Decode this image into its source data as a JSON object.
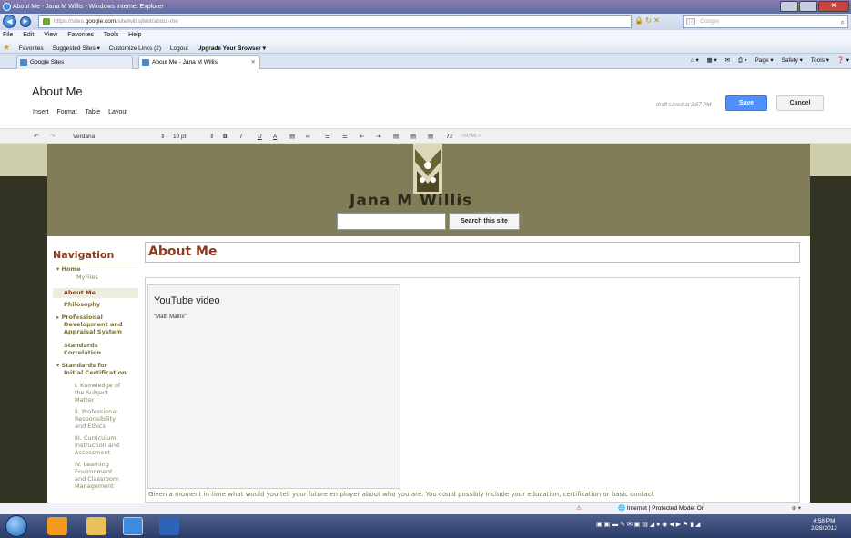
{
  "window": {
    "title": "About Me - Jana M Willis - Windows Internet Explorer",
    "controls": [
      "minimize",
      "maximize",
      "close"
    ]
  },
  "address_bar": {
    "url_prefix": "https://sites.",
    "url_domain": "google.com",
    "url_path": "/site/willisjtest/about-me",
    "search_placeholder": "Google"
  },
  "menu": [
    "File",
    "Edit",
    "View",
    "Favorites",
    "Tools",
    "Help"
  ],
  "favorites_bar": {
    "favorites_label": "Favorites",
    "links": [
      "Suggested Sites ▾",
      "Customize Links (2)",
      "Logout",
      "Upgrade Your Browser ▾"
    ]
  },
  "tabs": [
    {
      "label": "Google Sites"
    },
    {
      "label": "About Me - Jana M Willis"
    }
  ],
  "command_bar": [
    "Page ▾",
    "Safety ▾",
    "Tools ▾"
  ],
  "editor": {
    "page_title": "About Me",
    "draft_status": "draft saved at 2:57 PM",
    "save_label": "Save",
    "cancel_label": "Cancel",
    "menu": [
      "Insert",
      "Format",
      "Table",
      "Layout"
    ],
    "font": "Verdana",
    "size": "10 pt",
    "html_label": "<HTML>"
  },
  "site": {
    "name": "Jana M Willis",
    "search_button": "Search this site",
    "navigation": {
      "title": "Navigation",
      "items": [
        {
          "label": "▾ Home",
          "style": "bold"
        },
        {
          "label": "MyFiles",
          "style": "sub"
        },
        {
          "label": "About Me",
          "style": "sel"
        },
        {
          "label": "Philosophy",
          "style": "bold"
        },
        {
          "label": "▸ Professional",
          "style": "bold"
        },
        {
          "label": "Development and",
          "style": "bold"
        },
        {
          "label": "Appraisal System",
          "style": "bold"
        },
        {
          "label": "Standards",
          "style": "bold"
        },
        {
          "label": "Correlation",
          "style": "bold"
        },
        {
          "label": "▾ Standards for",
          "style": "bold"
        },
        {
          "label": "Initial Certification",
          "style": "bold"
        },
        {
          "label": "I. Knowledge of",
          "style": "sub"
        },
        {
          "label": "the Subject",
          "style": "sub"
        },
        {
          "label": "Matter",
          "style": "sub"
        },
        {
          "label": "II. Professional",
          "style": "sub"
        },
        {
          "label": "Responsibility",
          "style": "sub"
        },
        {
          "label": "and Ethics",
          "style": "sub"
        },
        {
          "label": "III. Curriculum,",
          "style": "sub"
        },
        {
          "label": "Instruction and",
          "style": "sub"
        },
        {
          "label": "Assessment",
          "style": "sub"
        },
        {
          "label": "IV. Learning",
          "style": "sub"
        },
        {
          "label": "Environment",
          "style": "sub"
        },
        {
          "label": "and Classroom",
          "style": "sub"
        },
        {
          "label": "Management",
          "style": "sub"
        }
      ]
    },
    "content": {
      "title": "About Me",
      "youtube_title": "YouTube video",
      "youtube_subtitle": "\"Math Matrix\"",
      "body_text": "Given a moment in time what would you tell your future employer about who you are. You could possibly include your education, certification or basic contact"
    }
  },
  "status_bar": {
    "zone": "Internet | Protected Mode: On",
    "zoom": "⊕ ▾"
  },
  "taskbar": {
    "time": "4:58 PM",
    "date": "2/28/2012"
  },
  "colors": {
    "header_olive": "#817d58",
    "nav_title": "#8c3b1e",
    "save_blue": "#4d90fe"
  }
}
